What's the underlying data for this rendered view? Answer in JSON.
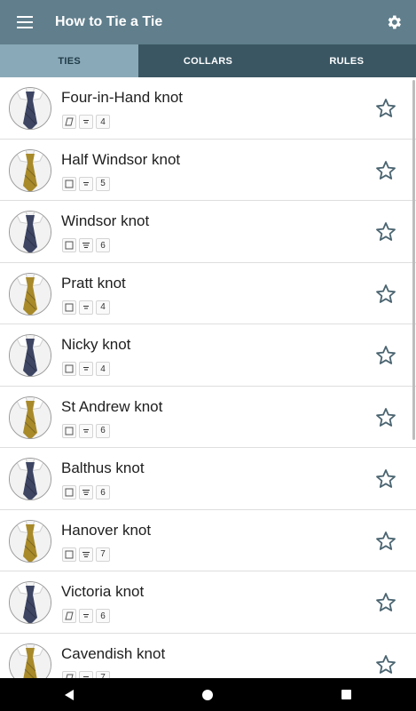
{
  "app": {
    "title": "How to Tie a Tie"
  },
  "tabs": [
    {
      "label": "TIES",
      "active": true
    },
    {
      "label": "COLLARS",
      "active": false
    },
    {
      "label": "RULES",
      "active": false
    }
  ],
  "knots": [
    {
      "name": "Four-in-Hand knot",
      "shape_icon": "slanted",
      "layers_icon": "layers-small",
      "count": "4",
      "tie_color": "navy"
    },
    {
      "name": "Half Windsor knot",
      "shape_icon": "square",
      "layers_icon": "layers-small",
      "count": "5",
      "tie_color": "gold"
    },
    {
      "name": "Windsor knot",
      "shape_icon": "square",
      "layers_icon": "layers-large",
      "count": "6",
      "tie_color": "navy"
    },
    {
      "name": "Pratt knot",
      "shape_icon": "square",
      "layers_icon": "layers-small",
      "count": "4",
      "tie_color": "gold"
    },
    {
      "name": "Nicky knot",
      "shape_icon": "square",
      "layers_icon": "layers-small",
      "count": "4",
      "tie_color": "navy"
    },
    {
      "name": "St Andrew knot",
      "shape_icon": "square",
      "layers_icon": "layers-small",
      "count": "6",
      "tie_color": "gold"
    },
    {
      "name": "Balthus knot",
      "shape_icon": "square",
      "layers_icon": "layers-large",
      "count": "6",
      "tie_color": "navy"
    },
    {
      "name": "Hanover knot",
      "shape_icon": "square",
      "layers_icon": "layers-large",
      "count": "7",
      "tie_color": "gold"
    },
    {
      "name": "Victoria knot",
      "shape_icon": "slanted",
      "layers_icon": "layers-small",
      "count": "6",
      "tie_color": "navy"
    },
    {
      "name": "Cavendish knot",
      "shape_icon": "slanted",
      "layers_icon": "layers-small",
      "count": "7",
      "tie_color": "gold"
    }
  ],
  "colors": {
    "appbar": "#607e8c",
    "tabbar": "#3a5663",
    "tab_active": "#8aa9b8",
    "star": "#4a6470",
    "navy_tie": "#3d4563",
    "gold_tie": "#a88a2a"
  }
}
